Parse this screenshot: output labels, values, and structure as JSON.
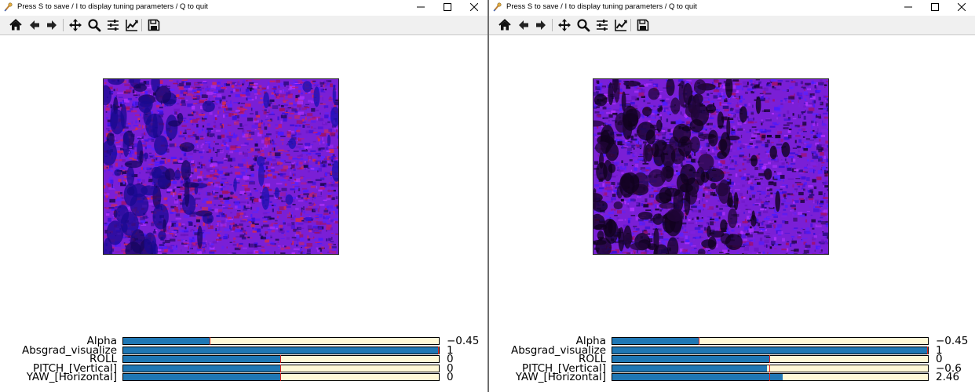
{
  "windows": [
    {
      "id": "left",
      "title": "Press S to save / I to display tuning parameters / Q to quit",
      "toolbar": [
        "home-icon",
        "back-icon",
        "forward-icon",
        "pan-icon",
        "zoom-icon",
        "configure-subplots-icon",
        "edit-axis-icon",
        "save-icon"
      ],
      "sliders": [
        {
          "label": "Alpha",
          "value": "−0.45",
          "fraction": 0.275,
          "init_fraction": 0.275
        },
        {
          "label": "Absgrad_visualize",
          "value": "1",
          "fraction": 1.0,
          "init_fraction": 1.0
        },
        {
          "label": "ROLL",
          "value": "0",
          "fraction": 0.5,
          "init_fraction": 0.5
        },
        {
          "label": "PITCH_[Vertical]",
          "value": "0",
          "fraction": 0.5,
          "init_fraction": 0.5
        },
        {
          "label": "YAW_[Horizontal]",
          "value": "0",
          "fraction": 0.5,
          "init_fraction": 0.5
        }
      ]
    },
    {
      "id": "right",
      "title": "Press S to save / I to display tuning parameters / Q to quit",
      "toolbar": [
        "home-icon",
        "back-icon",
        "forward-icon",
        "pan-icon",
        "zoom-icon",
        "configure-subplots-icon",
        "edit-axis-icon",
        "save-icon"
      ],
      "sliders": [
        {
          "label": "Alpha",
          "value": "−0.45",
          "fraction": 0.275,
          "init_fraction": 0.275
        },
        {
          "label": "Absgrad_visualize",
          "value": "1",
          "fraction": 1.0,
          "init_fraction": 1.0
        },
        {
          "label": "ROLL",
          "value": "0",
          "fraction": 0.5,
          "init_fraction": 0.5
        },
        {
          "label": "PITCH_[Vertical]",
          "value": "−0.6",
          "fraction": 0.49,
          "init_fraction": 0.5
        },
        {
          "label": "YAW_[Horizontal]",
          "value": "2.46",
          "fraction": 0.541,
          "init_fraction": 0.5
        }
      ]
    }
  ],
  "colors": {
    "slider_fill": "#1f77b4",
    "slider_track": "#fff9d6",
    "slider_init_marker": "#e0221a",
    "image_base": "#7a1fd6"
  }
}
